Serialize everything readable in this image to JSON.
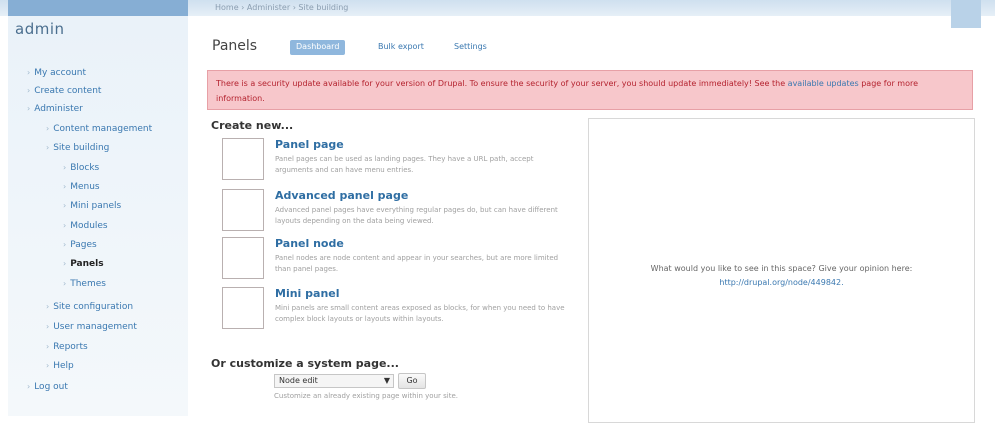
{
  "breadcrumb": "Home › Administer › Site building",
  "sidebar": {
    "site_name": "admin",
    "items": [
      {
        "label": "My account"
      },
      {
        "label": "Create content"
      },
      {
        "label": "Administer"
      },
      {
        "label": "Content management"
      },
      {
        "label": "Site building"
      },
      {
        "label": "Blocks"
      },
      {
        "label": "Menus"
      },
      {
        "label": "Mini panels"
      },
      {
        "label": "Modules"
      },
      {
        "label": "Pages"
      },
      {
        "label": "Panels"
      },
      {
        "label": "Themes"
      },
      {
        "label": "Site configuration"
      },
      {
        "label": "User management"
      },
      {
        "label": "Reports"
      },
      {
        "label": "Help"
      },
      {
        "label": "Log out"
      }
    ]
  },
  "page": {
    "title": "Panels",
    "tabs": [
      {
        "label": "Dashboard",
        "active": true
      },
      {
        "label": "Bulk export",
        "active": false
      },
      {
        "label": "Settings",
        "active": false
      }
    ]
  },
  "alert": {
    "text": "There is a security update available for your version of Drupal. To ensure the security of your server, you should update immediately! See the ",
    "link": "available updates",
    "text2": " page for more information."
  },
  "create": {
    "heading": "Create new...",
    "items": [
      {
        "title": "Panel page",
        "desc": "Panel pages can be used as landing pages. They have a URL path, accept arguments and can have menu entries."
      },
      {
        "title": "Advanced panel page",
        "desc": "Advanced panel pages have everything regular pages do, but can have different layouts depending on the data being viewed."
      },
      {
        "title": "Panel node",
        "desc": "Panel nodes are node content and appear in your searches, but are more limited than panel pages."
      },
      {
        "title": "Mini panel",
        "desc": "Mini panels are small content areas exposed as blocks, for when you need to have complex block layouts or layouts within layouts."
      }
    ]
  },
  "customize": {
    "heading": "Or customize a system page...",
    "select_value": "Node edit",
    "go_label": "Go",
    "desc": "Customize an already existing page within your site."
  },
  "panel": {
    "text": "What would you like to see in this space? Give your opinion here:",
    "link": "http://drupal.org/node/449842."
  },
  "colors": {
    "link": "#3a78b0",
    "alert_bg": "#f7c7cb",
    "alert_text": "#b4232f",
    "tab_active": "#8fb7dd"
  }
}
